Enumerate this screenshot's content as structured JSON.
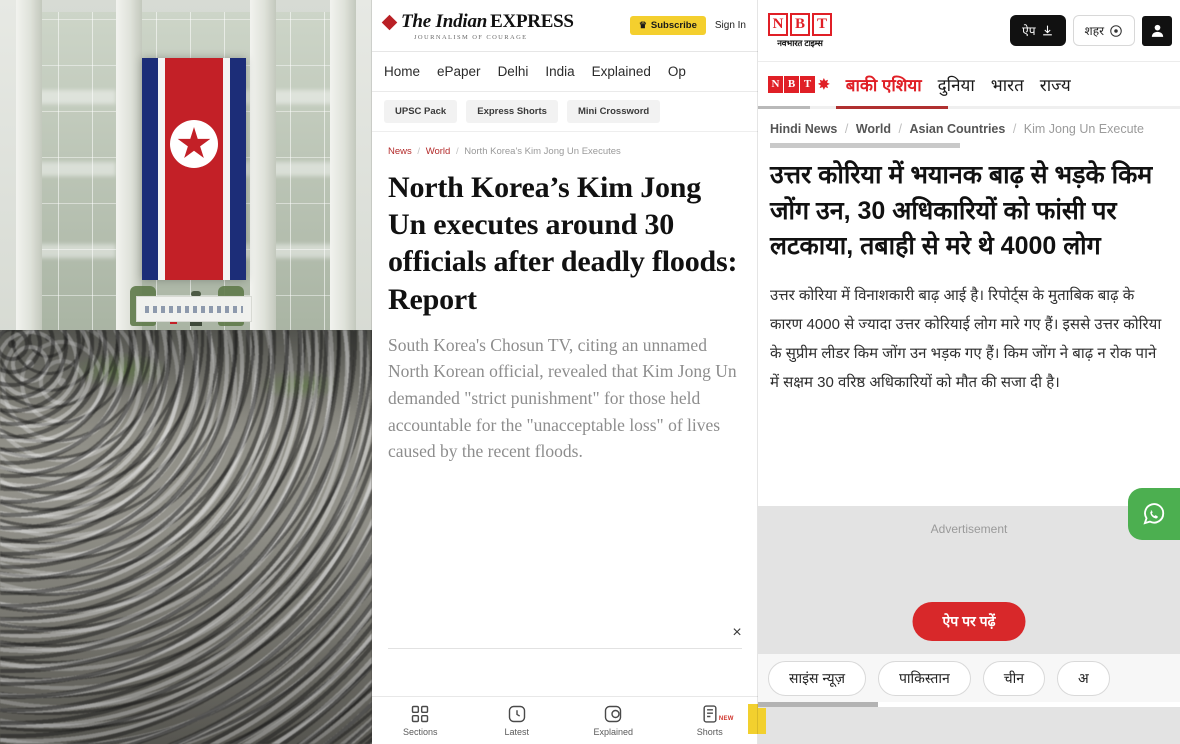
{
  "photo": {
    "alt_description": "North Korean flag banner hanging on a building facade with a large crowd gathered below"
  },
  "indian_express": {
    "logo": {
      "the": "The Indian",
      "express": "EXPRESS",
      "tagline": "JOURNALISM OF COURAGE"
    },
    "subscribe_label": "Subscribe",
    "signin_label": "Sign In",
    "nav": [
      "Home",
      "ePaper",
      "Delhi",
      "India",
      "Explained",
      "Op"
    ],
    "chips": [
      "UPSC Pack",
      "Express Shorts",
      "Mini Crossword"
    ],
    "breadcrumb": {
      "b1": "News",
      "b2": "World",
      "b3": "North Korea's Kim Jong Un Executes"
    },
    "headline": "North Korea’s Kim Jong Un executes around 30 officials after deadly floods: Report",
    "standfirst": "South Korea's Chosun TV, citing an unnamed North Korean official, revealed that Kim Jong Un demanded \"strict punishment\" for those held accountable for the \"unacceptable loss\" of lives caused by the recent floods.",
    "close_label": "×",
    "bottom_nav": [
      {
        "label": "Sections",
        "icon": "grid-icon",
        "badge": ""
      },
      {
        "label": "Latest",
        "icon": "clock-icon",
        "badge": ""
      },
      {
        "label": "Explained",
        "icon": "explained-icon",
        "badge": ""
      },
      {
        "label": "Shorts",
        "icon": "shorts-icon",
        "badge": "NEW"
      }
    ]
  },
  "navbharat_times": {
    "logo": {
      "l1": "N",
      "l2": "B",
      "l3": "T",
      "sub": "नवभारत टाइम्स"
    },
    "app_button": "ऐप",
    "city_button": "शहर",
    "nav_brand": {
      "n": "N",
      "b": "B",
      "t": "T",
      "plus": "✸"
    },
    "nav": [
      "बाकी एशिया",
      "दुनिया",
      "भारत",
      "राज्य"
    ],
    "nav_active_index": 0,
    "breadcrumb": {
      "b1": "Hindi News",
      "b2": "World",
      "b3": "Asian Countries",
      "b4": "Kim Jong Un Execute"
    },
    "headline": "उत्तर कोरिया में भयानक बाढ़ से भड़के किम जोंग उन, 30 अधिकारियों को फांसी पर लटकाया, तबाही से मरे थे 4000 लोग",
    "summary": "उत्तर कोरिया में विनाशकारी बाढ़ आई है। रिपोर्ट्स के मुताबिक बाढ़ के कारण 4000 से ज्यादा उत्तर कोरियाई लोग मारे गए हैं। इससे उत्तर कोरिया के सुप्रीम लीडर किम जोंग उन भड़क गए हैं। किम जोंग ने बाढ़ न रोक पाने में सक्षम 30 वरिष्ठ अधिकारियों को मौत की सजा दी है।",
    "ad_label": "Advertisement",
    "ad_cta": "ऐप पर पढ़ें",
    "tags": [
      "साइंस न्यूज़",
      "पाकिस्तान",
      "चीन",
      "अ"
    ],
    "whatsapp_icon": "whatsapp-icon"
  },
  "colors": {
    "express_yellow": "#f4cf2e",
    "express_red": "#b92025",
    "nbt_red": "#e01f26",
    "nbt_cta_red": "#d8282a",
    "whatsapp_green": "#4caf50",
    "flag_red": "#c32027",
    "flag_blue": "#1c2d78"
  }
}
